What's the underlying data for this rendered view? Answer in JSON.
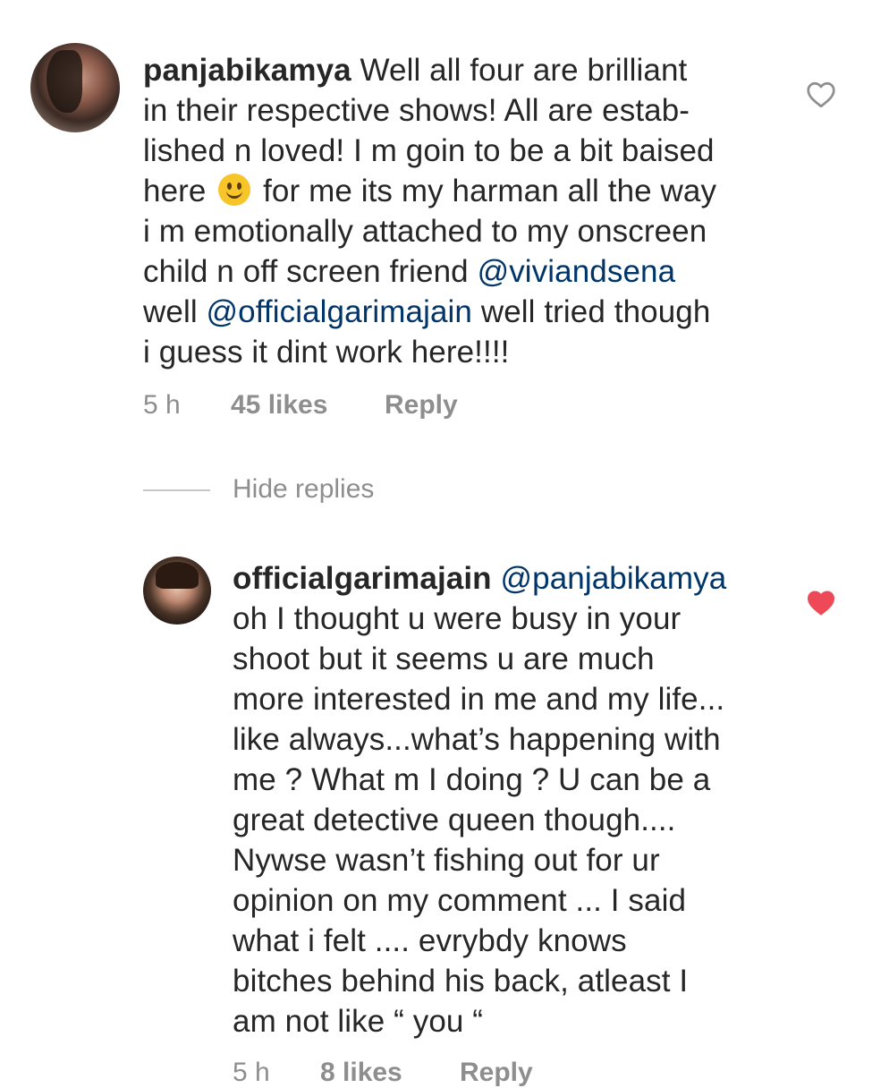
{
  "comments": [
    {
      "username": "panjabikamya",
      "lines": [
        [
          {
            "t": "Well all four are brilliant"
          }
        ],
        [
          {
            "t": "in their respective shows! All are estab-"
          }
        ],
        [
          {
            "t": "lished n loved! I m goin to be a bit baised"
          }
        ],
        [
          {
            "t": "here "
          },
          {
            "emoji": "slightly-smiling-face-emoji"
          },
          {
            "t": " for me its my harman all the way"
          }
        ],
        [
          {
            "t": "i m emotionally attached to my onscreen"
          }
        ],
        [
          {
            "t": "child n off screen friend "
          },
          {
            "m": "@viviandsena"
          }
        ],
        [
          {
            "t": "well "
          },
          {
            "m": "@officialgarimajain"
          },
          {
            "t": " well tried though"
          }
        ],
        [
          {
            "t": "i guess it dint work here!!!!"
          }
        ]
      ],
      "time": "5 h",
      "likes": "45 likes",
      "reply": "Reply",
      "liked": false
    }
  ],
  "hide_replies": "Hide replies",
  "reply_comment": {
    "username": "officialgarimajain",
    "lines": [
      [
        {
          "m": "@panjabikamya"
        }
      ],
      [
        {
          "t": "oh I thought u were busy in your"
        }
      ],
      [
        {
          "t": "shoot but it seems u are much"
        }
      ],
      [
        {
          "t": "more interested in me and my life..."
        }
      ],
      [
        {
          "t": "like always...what’s happening with"
        }
      ],
      [
        {
          "t": "me ? What m I doing ? U can be a"
        }
      ],
      [
        {
          "t": "great detective queen though...."
        }
      ],
      [
        {
          "t": "Nywse wasn’t fishing out for ur"
        }
      ],
      [
        {
          "t": "opinion on my comment ... I said"
        }
      ],
      [
        {
          "t": "what i felt .... evrybdy knows"
        }
      ],
      [
        {
          "t": "bitches behind his back, atleast I"
        }
      ],
      [
        {
          "t": "am not like “ you “"
        }
      ]
    ],
    "time": "5 h",
    "likes": "8 likes",
    "reply": "Reply",
    "liked": true
  },
  "icons": {
    "heart_outline": "heart-outline-icon",
    "heart_filled": "heart-filled-icon"
  },
  "colors": {
    "text": "#262626",
    "mention": "#003569",
    "meta": "#8e8e8e",
    "liked": "#ed4956"
  }
}
